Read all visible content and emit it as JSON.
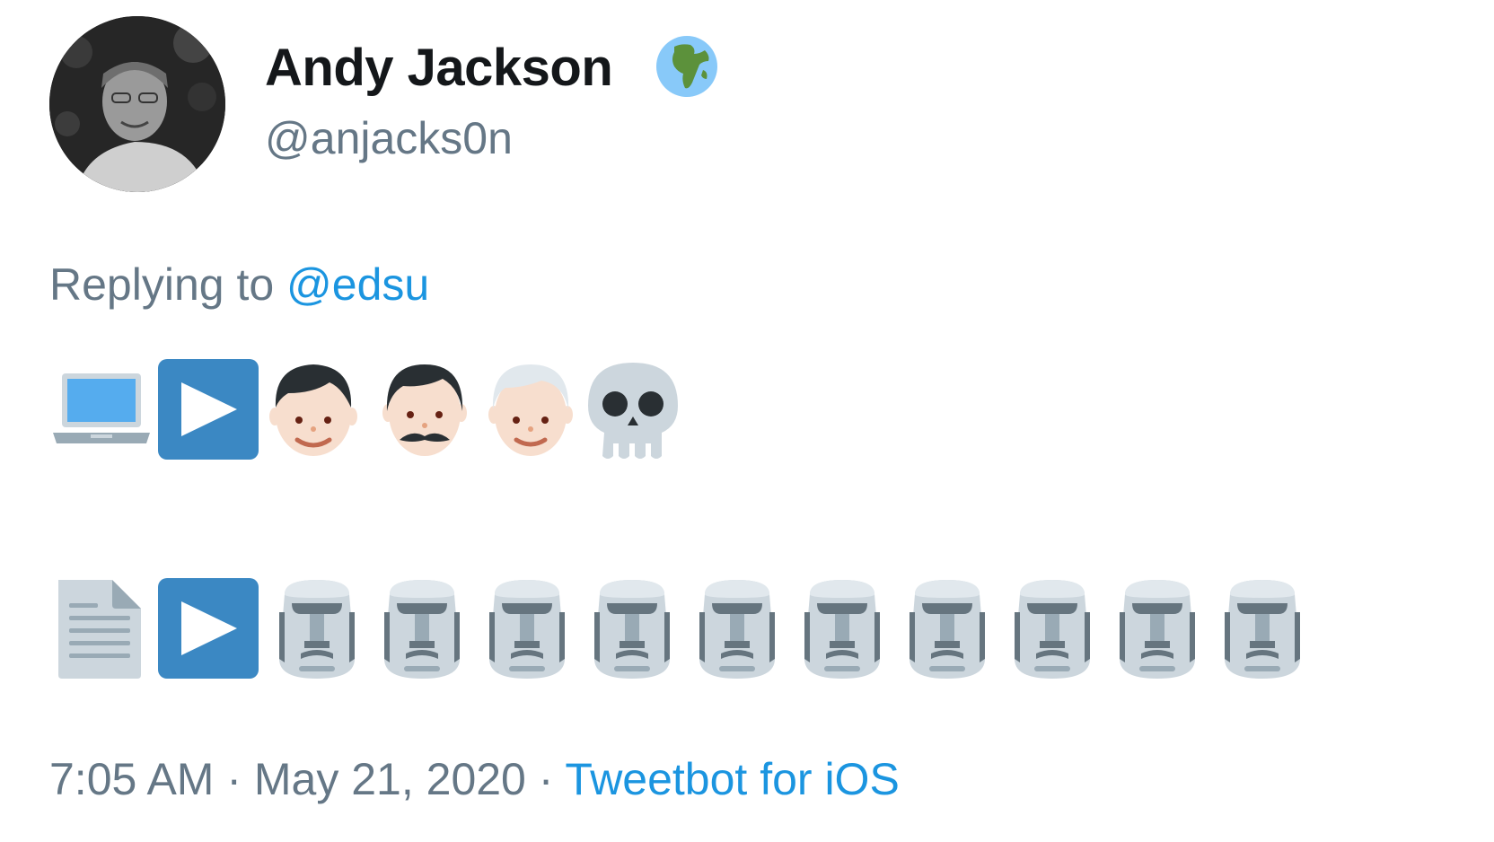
{
  "author": {
    "name": "Andy Jackson",
    "handle": "@anjacks0n",
    "badge_icon": "globe-europe-africa-icon"
  },
  "reply": {
    "prefix": "Replying to ",
    "mention": "@edsu"
  },
  "emoji_rows": [
    [
      "laptop-icon",
      "play-button-icon",
      "boy-icon",
      "man-mustache-icon",
      "older-man-icon",
      "skull-icon"
    ],
    [
      "page-facing-up-icon",
      "play-button-icon",
      "moai-icon",
      "moai-icon",
      "moai-icon",
      "moai-icon",
      "moai-icon",
      "moai-icon",
      "moai-icon",
      "moai-icon",
      "moai-icon",
      "moai-icon"
    ]
  ],
  "meta": {
    "time": "7:05 AM",
    "separator": " · ",
    "date": "May 21, 2020",
    "source": "Tweetbot for iOS"
  },
  "colors": {
    "text_primary": "#14171a",
    "text_secondary": "#657786",
    "link": "#1b95e0",
    "play_button": "#3b88c3",
    "moai": "#ccd6dd",
    "moai_dark": "#66757f"
  }
}
